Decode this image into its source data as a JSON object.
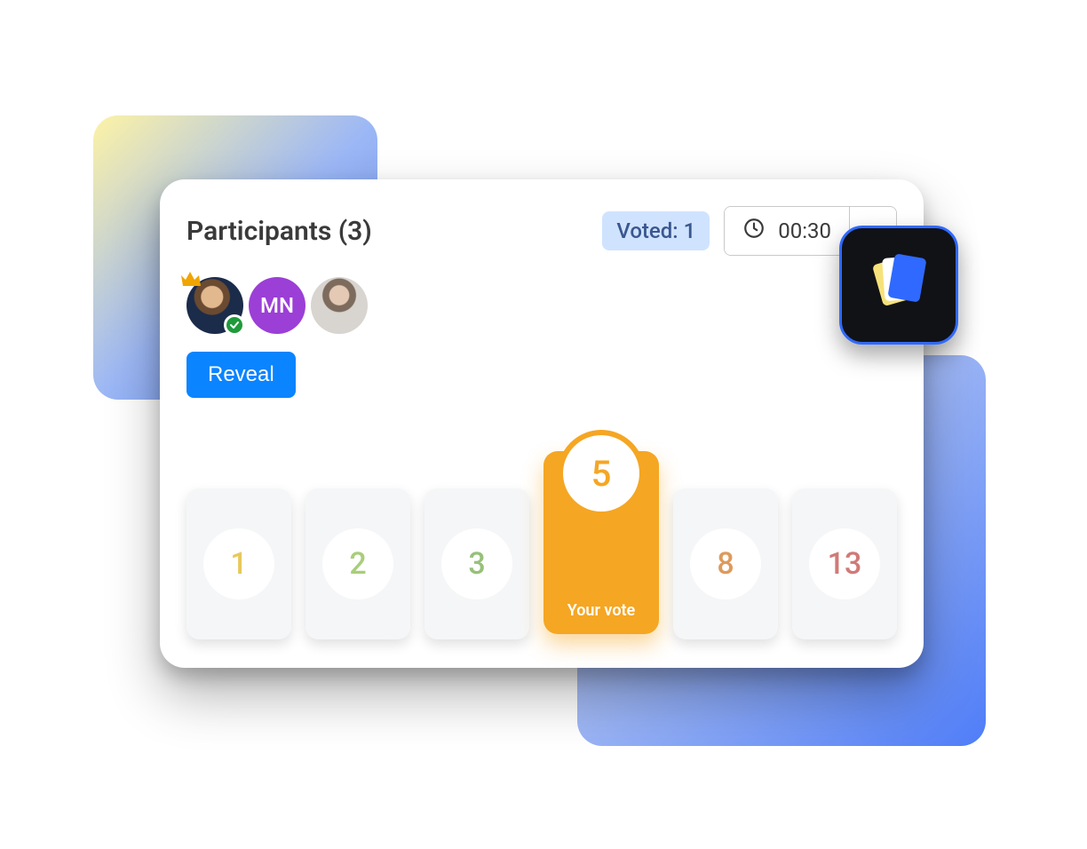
{
  "header": {
    "title": "Participants (3)",
    "voted_label": "Voted: 1",
    "timer": "00:30"
  },
  "participants": [
    {
      "type": "photo",
      "is_host": true,
      "has_voted": true
    },
    {
      "type": "initials",
      "initials": "MN",
      "is_host": false,
      "has_voted": false
    },
    {
      "type": "photo",
      "is_host": false,
      "has_voted": false
    }
  ],
  "actions": {
    "reveal_label": "Reveal"
  },
  "cards": {
    "values": [
      "1",
      "2",
      "3",
      "5",
      "8",
      "13"
    ],
    "selected_value": "5",
    "your_vote_label": "Your vote"
  },
  "colors": {
    "primary": "#0a84ff",
    "accent_orange": "#f5a623",
    "voted_badge_bg": "#cfe3ff",
    "avatar_initials_bg": "#9b3fd6",
    "check_badge": "#1f9a3b"
  }
}
